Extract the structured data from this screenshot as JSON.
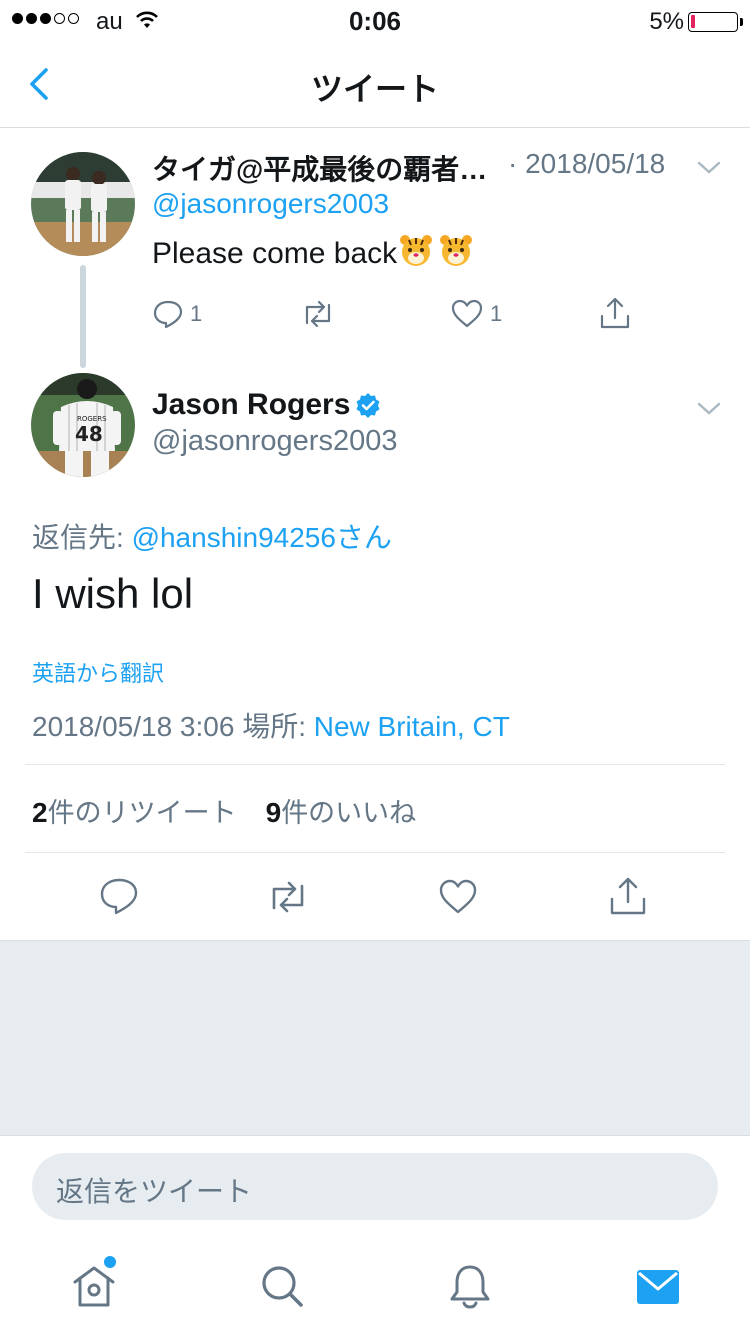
{
  "status_bar": {
    "carrier": "au",
    "time": "0:06",
    "battery": "5%"
  },
  "nav": {
    "title": "ツイート"
  },
  "parent_tweet": {
    "name": "タイガ@平成最後の覇者…",
    "date": "· 2018/05/18",
    "handle": "@jasonrogers2003",
    "text": "Please come back",
    "emoji": "tiger-face-icon",
    "reply_count": "1",
    "like_count": "1"
  },
  "main_tweet": {
    "name": "Jason Rogers",
    "handle": "@jasonrogers2003",
    "reply_label": "返信先: ",
    "reply_target": "@hanshin94256さん",
    "text": "I wish lol",
    "translate": "英語から翻訳",
    "datetime": "2018/05/18 3:06 ",
    "location_label": "場所: ",
    "location": "New Britain, CT",
    "retweet_count": "2",
    "retweet_label": "件のリツイート",
    "like_count": "9",
    "like_label": "件のいいね"
  },
  "composer": {
    "placeholder": "返信をツイート"
  },
  "colors": {
    "accent": "#1da1f2",
    "secondary_text": "#657786",
    "background_gray": "#e6ecf0"
  }
}
